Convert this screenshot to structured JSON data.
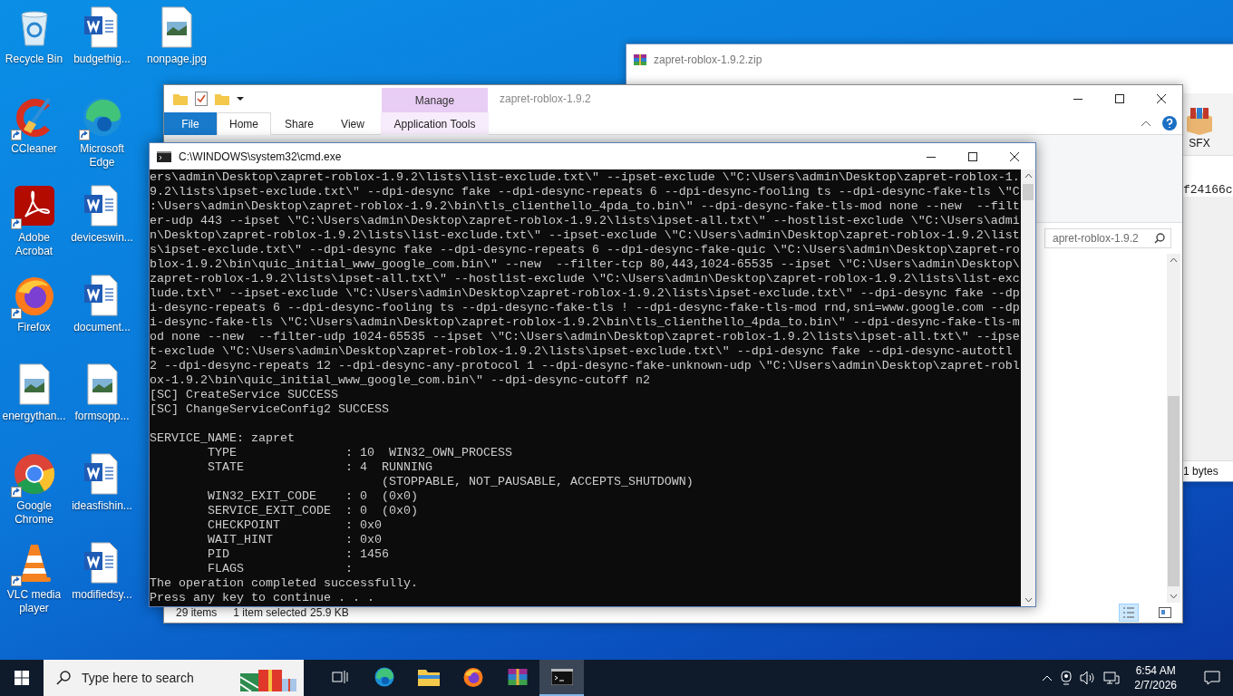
{
  "desktop_icons": [
    {
      "label": "Recycle Bin",
      "kind": "recycle",
      "shortcut": false
    },
    {
      "label": "CCleaner",
      "kind": "ccleaner",
      "shortcut": true
    },
    {
      "label": "Adobe Acrobat",
      "kind": "acrobat",
      "shortcut": true
    },
    {
      "label": "Firefox",
      "kind": "firefox",
      "shortcut": true
    },
    {
      "label": "energythan...",
      "kind": "image",
      "shortcut": false
    },
    {
      "label": "Google Chrome",
      "kind": "chrome",
      "shortcut": true
    },
    {
      "label": "VLC media player",
      "kind": "vlc",
      "shortcut": true
    },
    {
      "label": "budgethig...",
      "kind": "word",
      "shortcut": false
    },
    {
      "label": "Microsoft Edge",
      "kind": "edge",
      "shortcut": true
    },
    {
      "label": "deviceswin...",
      "kind": "word",
      "shortcut": false
    },
    {
      "label": "document...",
      "kind": "word",
      "shortcut": false
    },
    {
      "label": "formsopp...",
      "kind": "image",
      "shortcut": false
    },
    {
      "label": "ideasfishin...",
      "kind": "word",
      "shortcut": false
    },
    {
      "label": "modifiedsy...",
      "kind": "word",
      "shortcut": false
    },
    {
      "label": "nonpage.jpg",
      "kind": "image",
      "shortcut": false
    }
  ],
  "winrar": {
    "title": "zapret-roblox-1.9.2.zip",
    "tool": "SFX",
    "comment": "f24166c",
    "status": "1 bytes"
  },
  "explorer": {
    "title": "zapret-roblox-1.9.2",
    "context_tab": "Manage",
    "tabs": [
      {
        "label": "File",
        "kind": "file",
        "selected": false
      },
      {
        "label": "Home",
        "kind": "normal",
        "selected": true
      },
      {
        "label": "Share",
        "kind": "normal",
        "selected": false
      },
      {
        "label": "View",
        "kind": "normal",
        "selected": false
      },
      {
        "label": "Application Tools",
        "kind": "context",
        "selected": false
      }
    ],
    "search": {
      "placeholder": "apret-roblox-1.9.2"
    },
    "status": {
      "items": "29 items",
      "selection": "1 item selected",
      "size": "25.9 KB"
    },
    "views": [
      {
        "kind": "details",
        "selected": true
      },
      {
        "kind": "tiles",
        "selected": false
      }
    ]
  },
  "cmd": {
    "title": "C:\\WINDOWS\\system32\\cmd.exe",
    "lines": [
      {
        "text": "ers\\admin\\Desktop\\zapret-roblox-1.9.2\\lists\\list-exclude.txt\\\" --ipset-exclude \\\"C:\\Users\\admin\\Desktop\\zapret-roblox-1.",
        "gap_before": false
      },
      {
        "text": "9.2\\lists\\ipset-exclude.txt\\\" --dpi-desync fake --dpi-desync-repeats 6 --dpi-desync-fooling ts --dpi-desync-fake-tls \\\"C",
        "gap_before": false
      },
      {
        "text": ":\\Users\\admin\\Desktop\\zapret-roblox-1.9.2\\bin\\tls_clienthello_4pda_to.bin\\\" --dpi-desync-fake-tls-mod none --new  --filt",
        "gap_before": false
      },
      {
        "text": "er-udp 443 --ipset \\\"C:\\Users\\admin\\Desktop\\zapret-roblox-1.9.2\\lists\\ipset-all.txt\\\" --hostlist-exclude \\\"C:\\Users\\admi",
        "gap_before": false
      },
      {
        "text": "n\\Desktop\\zapret-roblox-1.9.2\\lists\\list-exclude.txt\\\" --ipset-exclude \\\"C:\\Users\\admin\\Desktop\\zapret-roblox-1.9.2\\list",
        "gap_before": false
      },
      {
        "text": "s\\ipset-exclude.txt\\\" --dpi-desync fake --dpi-desync-repeats 6 --dpi-desync-fake-quic \\\"C:\\Users\\admin\\Desktop\\zapret-ro",
        "gap_before": false
      },
      {
        "text": "blox-1.9.2\\bin\\quic_initial_www_google_com.bin\\\" --new  --filter-tcp 80,443,1024-65535 --ipset \\\"C:\\Users\\admin\\Desktop\\",
        "gap_before": false
      },
      {
        "text": "zapret-roblox-1.9.2\\lists\\ipset-all.txt\\\" --hostlist-exclude \\\"C:\\Users\\admin\\Desktop\\zapret-roblox-1.9.2\\lists\\list-exc",
        "gap_before": false
      },
      {
        "text": "lude.txt\\\" --ipset-exclude \\\"C:\\Users\\admin\\Desktop\\zapret-roblox-1.9.2\\lists\\ipset-exclude.txt\\\" --dpi-desync fake --dp",
        "gap_before": false
      },
      {
        "text": "i-desync-repeats 6 --dpi-desync-fooling ts --dpi-desync-fake-tls ! --dpi-desync-fake-tls-mod rnd,sni=www.google.com --dp",
        "gap_before": false
      },
      {
        "text": "i-desync-fake-tls \\\"C:\\Users\\admin\\Desktop\\zapret-roblox-1.9.2\\bin\\tls_clienthello_4pda_to.bin\\\" --dpi-desync-fake-tls-m",
        "gap_before": false
      },
      {
        "text": "od none --new  --filter-udp 1024-65535 --ipset \\\"C:\\Users\\admin\\Desktop\\zapret-roblox-1.9.2\\lists\\ipset-all.txt\\\" --ipse",
        "gap_before": false
      },
      {
        "text": "t-exclude \\\"C:\\Users\\admin\\Desktop\\zapret-roblox-1.9.2\\lists\\ipset-exclude.txt\\\" --dpi-desync fake --dpi-desync-autottl",
        "gap_before": false
      },
      {
        "text": "2 --dpi-desync-repeats 12 --dpi-desync-any-protocol 1 --dpi-desync-fake-unknown-udp \\\"C:\\Users\\admin\\Desktop\\zapret-robl",
        "gap_before": false
      },
      {
        "text": "ox-1.9.2\\bin\\quic_initial_www_google_com.bin\\\" --dpi-desync-cutoff n2",
        "gap_before": false
      },
      {
        "text": "[SC] CreateService SUCCESS",
        "gap_before": false
      },
      {
        "text": "[SC] ChangeServiceConfig2 SUCCESS",
        "gap_before": false
      },
      {
        "text": "SERVICE_NAME: zapret",
        "gap_before": true
      },
      {
        "text": "        TYPE               : 10  WIN32_OWN_PROCESS",
        "gap_before": false
      },
      {
        "text": "        STATE              : 4  RUNNING",
        "gap_before": false
      },
      {
        "text": "                                (STOPPABLE, NOT_PAUSABLE, ACCEPTS_SHUTDOWN)",
        "gap_before": false
      },
      {
        "text": "        WIN32_EXIT_CODE    : 0  (0x0)",
        "gap_before": false
      },
      {
        "text": "        SERVICE_EXIT_CODE  : 0  (0x0)",
        "gap_before": false
      },
      {
        "text": "        CHECKPOINT         : 0x0",
        "gap_before": false
      },
      {
        "text": "        WAIT_HINT          : 0x0",
        "gap_before": false
      },
      {
        "text": "        PID                : 1456",
        "gap_before": false
      },
      {
        "text": "        FLAGS              :",
        "gap_before": false
      },
      {
        "text": "The operation completed successfully.",
        "gap_before": false
      },
      {
        "text": "Press any key to continue . . .",
        "gap_before": false
      }
    ]
  },
  "taskbar": {
    "search": {
      "placeholder": "Type here to search"
    },
    "apps": [
      {
        "kind": "taskview",
        "selected": false
      },
      {
        "kind": "edge",
        "selected": false
      },
      {
        "kind": "explorer",
        "selected": false
      },
      {
        "kind": "firefox",
        "selected": false
      },
      {
        "kind": "winrar",
        "selected": false
      },
      {
        "kind": "cmd",
        "selected": true
      }
    ],
    "time": "6:54 AM",
    "date": "2/7/2026"
  }
}
